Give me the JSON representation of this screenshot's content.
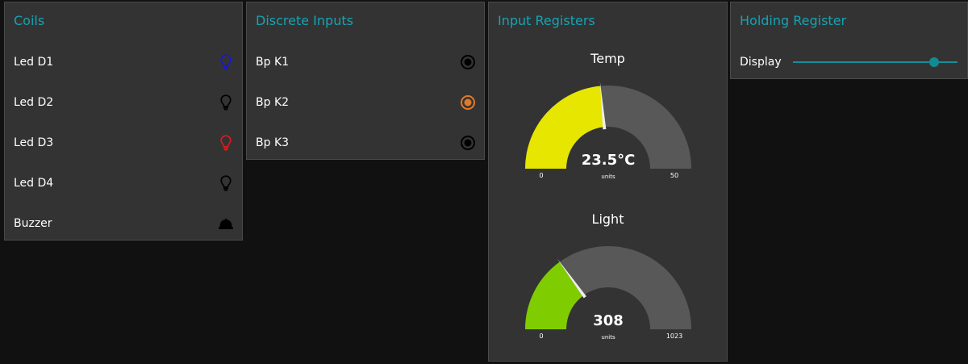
{
  "coils": {
    "title": "Coils",
    "items": [
      {
        "label": "Led D1",
        "icon": "lightbulb-icon",
        "color": "#1a16d6"
      },
      {
        "label": "Led D2",
        "icon": "lightbulb-icon",
        "color": "#000000"
      },
      {
        "label": "Led D3",
        "icon": "lightbulb-icon",
        "color": "#d91a1a"
      },
      {
        "label": "Led D4",
        "icon": "lightbulb-icon",
        "color": "#000000"
      },
      {
        "label": "Buzzer",
        "icon": "bell-icon",
        "color": "#000000"
      }
    ]
  },
  "discrete_inputs": {
    "title": "Discrete Inputs",
    "items": [
      {
        "label": "Bp K1",
        "icon": "radio-button-icon",
        "color": "#000000"
      },
      {
        "label": "Bp K2",
        "icon": "radio-button-icon",
        "color": "#e07a2a"
      },
      {
        "label": "Bp K3",
        "icon": "radio-button-icon",
        "color": "#000000"
      }
    ]
  },
  "input_registers": {
    "title": "Input Registers",
    "gauges": [
      {
        "title": "Temp",
        "value": 23.5,
        "value_text": "23.5°C",
        "units": "units",
        "min": 0,
        "max": 50,
        "min_text": "0",
        "max_text": "50",
        "color": "#e6e600"
      },
      {
        "title": "Light",
        "value": 308,
        "value_text": "308",
        "units": "units",
        "min": 0,
        "max": 1023,
        "min_text": "0",
        "max_text": "1023",
        "color": "#7fcc00"
      }
    ]
  },
  "holding_register": {
    "title": "Holding Register",
    "slider_label": "Display",
    "slider_level": 0.86
  },
  "colors": {
    "accent": "#16a3b3",
    "card": "#333333",
    "background": "#111111",
    "gauge_track": "#585858"
  }
}
